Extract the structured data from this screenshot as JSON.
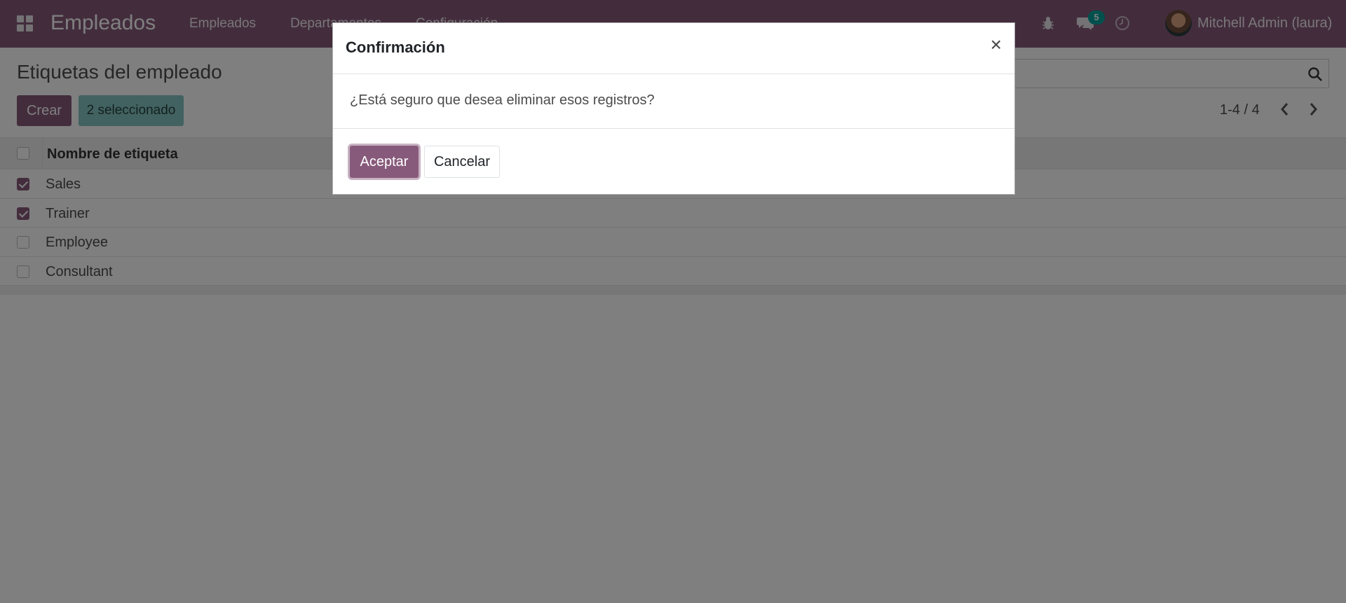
{
  "navbar": {
    "app_title": "Empleados",
    "menu": [
      "Empleados",
      "Departamentos",
      "Configuración"
    ],
    "messages_count": "5",
    "user_name": "Mitchell Admin (laura)",
    "color": "#875a7b"
  },
  "control_panel": {
    "title": "Etiquetas del empleado",
    "create_label": "Crear",
    "selected_label": "2 seleccionado",
    "pager": "1-4 / 4"
  },
  "list": {
    "column_header": "Nombre de etiqueta",
    "rows": [
      {
        "name": "Sales",
        "checked": true
      },
      {
        "name": "Trainer",
        "checked": true
      },
      {
        "name": "Employee",
        "checked": false
      },
      {
        "name": "Consultant",
        "checked": false
      }
    ]
  },
  "modal": {
    "title": "Confirmación",
    "close_label": "×",
    "message": "¿Está seguro que desea eliminar esos registros?",
    "accept_label": "Aceptar",
    "cancel_label": "Cancelar"
  },
  "icons": {
    "apps": "apps-grid-icon",
    "debug": "bug-icon",
    "messages": "chat-icon",
    "activities": "clock-icon",
    "search": "search-icon",
    "prev": "chevron-left-icon",
    "next": "chevron-right-icon"
  }
}
